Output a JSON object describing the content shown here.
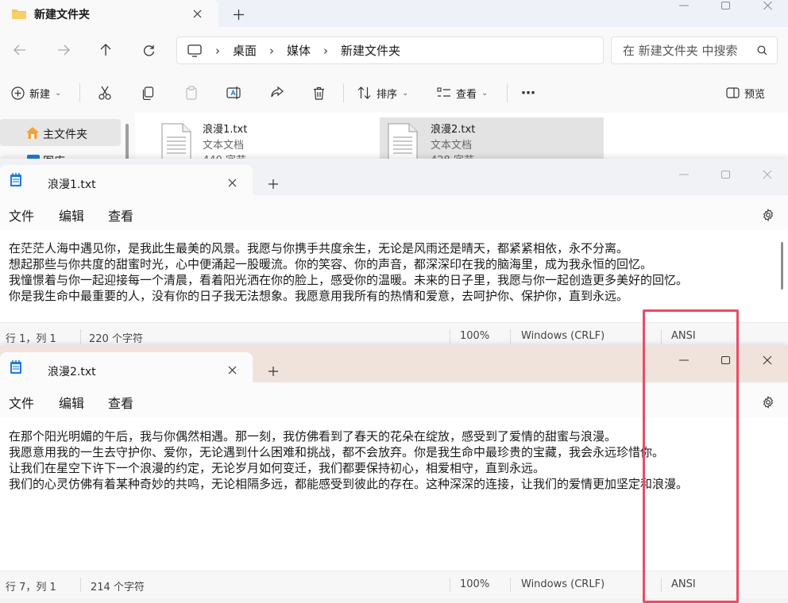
{
  "explorer": {
    "tab_title": "新建文件夹",
    "breadcrumb": [
      "桌面",
      "媒体",
      "新建文件夹"
    ],
    "search_placeholder": "在 新建文件夹 中搜索",
    "toolbar": {
      "new_label": "新建",
      "sort_label": "排序",
      "view_label": "查看",
      "preview_label": "预览"
    },
    "sidebar": {
      "home_label": "主文件夹",
      "gallery_label": "图库"
    },
    "files": [
      {
        "name": "浪漫1.txt",
        "type": "文本文档",
        "size": "440 字节"
      },
      {
        "name": "浪漫2.txt",
        "type": "文本文档",
        "size": "428 字节"
      }
    ]
  },
  "notepad1": {
    "tab_title": "浪漫1.txt",
    "menu": [
      "文件",
      "编辑",
      "查看"
    ],
    "lines": [
      "在茫茫人海中遇见你，是我此生最美的风景。我愿与你携手共度余生，无论是风雨还是晴天，都紧紧相依，永不分离。",
      "想起那些与你共度的甜蜜时光，心中便涌起一股暖流。你的笑容、你的声音，都深深印在我的脑海里，成为我永恒的回忆。",
      "我憧憬着与你一起迎接每一个清晨，看着阳光洒在你的脸上，感受你的温暖。未来的日子里，我愿与你一起创造更多美好的回忆。",
      "你是我生命中最重要的人，没有你的日子我无法想象。我愿意用我所有的热情和爱意，去呵护你、保护你，直到永远。"
    ],
    "status": {
      "position": "行 1，列 1",
      "chars": "220 个字符",
      "zoom": "100%",
      "eol": "Windows (CRLF)",
      "encoding": "ANSI"
    }
  },
  "notepad2": {
    "tab_title": "浪漫2.txt",
    "menu": [
      "文件",
      "编辑",
      "查看"
    ],
    "lines": [
      "在那个阳光明媚的午后，我与你偶然相遇。那一刻，我仿佛看到了春天的花朵在绽放，感受到了爱情的甜蜜与浪漫。",
      "我愿意用我的一生去守护你、爱你，无论遇到什么困难和挑战，都不会放弃。你是我生命中最珍贵的宝藏，我会永远珍惜你。",
      "让我们在星空下许下一个浪漫的约定，无论岁月如何变迁，我们都要保持初心，相爱相守，直到永远。",
      "我们的心灵仿佛有着某种奇妙的共鸣，无论相隔多远，都能感受到彼此的存在。这种深深的连接，让我们的爱情更加坚定和浪漫。"
    ],
    "status": {
      "position": "行 7，列 1",
      "chars": "214 个字符",
      "zoom": "100%",
      "eol": "Windows (CRLF)",
      "encoding": "ANSI"
    }
  },
  "colors": {
    "highlight": "#ec4b65",
    "folder": "#f2c44f",
    "notepad_icon": "#1f7ad6"
  }
}
